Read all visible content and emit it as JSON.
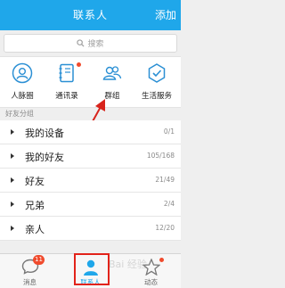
{
  "header": {
    "title": "联系人",
    "add_label": "添加"
  },
  "search": {
    "placeholder": "搜索"
  },
  "features": [
    {
      "label": "人脉圈",
      "icon": "face-circle-icon"
    },
    {
      "label": "通讯录",
      "icon": "address-book-icon"
    },
    {
      "label": "群组",
      "icon": "group-icon"
    },
    {
      "label": "生活服务",
      "icon": "service-shield-icon"
    }
  ],
  "section_label": "好友分组",
  "groups": [
    {
      "name": "我的设备",
      "count": "0/1"
    },
    {
      "name": "我的好友",
      "count": "105/168"
    },
    {
      "name": "好友",
      "count": "21/49"
    },
    {
      "name": "兄弟",
      "count": "2/4"
    },
    {
      "name": "亲人",
      "count": "12/20"
    }
  ],
  "tabs": [
    {
      "label": "消息",
      "badge": "11"
    },
    {
      "label": "联系人"
    },
    {
      "label": "动态"
    }
  ],
  "watermark": "Bai 经验",
  "colors": {
    "primary": "#1fa7ea",
    "highlight": "#e2231a",
    "badge": "#f04b2d"
  }
}
